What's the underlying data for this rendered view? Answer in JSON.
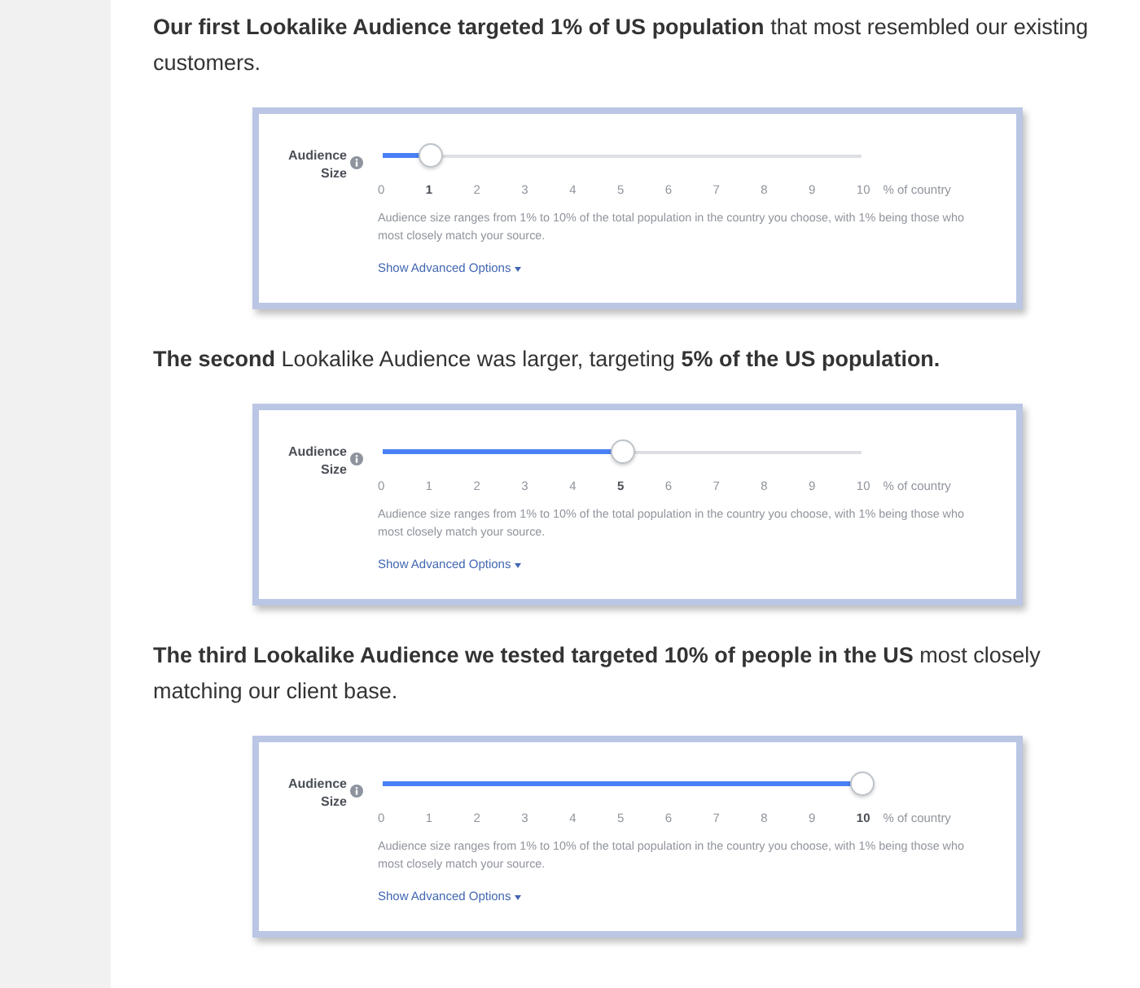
{
  "sections": [
    {
      "text": "**Our first Lookalike Audience targeted 1% of US population** that most resembled our existing customers.",
      "card": {
        "label": "Audience Size",
        "level": 0.1,
        "ticks": [
          {
            "label": "0",
            "selected": false
          },
          {
            "label": "1",
            "selected": true
          },
          {
            "label": "2",
            "selected": false
          },
          {
            "label": "3",
            "selected": false
          },
          {
            "label": "4",
            "selected": false
          },
          {
            "label": "5",
            "selected": false
          },
          {
            "label": "6",
            "selected": false
          },
          {
            "label": "7",
            "selected": false
          },
          {
            "label": "8",
            "selected": false
          },
          {
            "label": "9",
            "selected": false
          },
          {
            "label": "10",
            "selected": false
          }
        ],
        "unit": "% of country",
        "help": "Audience size ranges from 1% to 10% of the total population in the country you choose, with 1% being those who most closely match your source.",
        "link": "Show Advanced Options"
      }
    },
    {
      "text": "**The second** Lookalike Audience was larger, targeting **5% of the US population.**",
      "card": {
        "label": "Audience Size",
        "level": 0.5,
        "ticks": [
          {
            "label": "0",
            "selected": false
          },
          {
            "label": "1",
            "selected": false
          },
          {
            "label": "2",
            "selected": false
          },
          {
            "label": "3",
            "selected": false
          },
          {
            "label": "4",
            "selected": false
          },
          {
            "label": "5",
            "selected": true
          },
          {
            "label": "6",
            "selected": false
          },
          {
            "label": "7",
            "selected": false
          },
          {
            "label": "8",
            "selected": false
          },
          {
            "label": "9",
            "selected": false
          },
          {
            "label": "10",
            "selected": false
          }
        ],
        "unit": "% of country",
        "help": "Audience size ranges from 1% to 10% of the total population in the country you choose, with 1% being those who most closely match your source.",
        "link": "Show Advanced Options"
      }
    },
    {
      "text": "**The third Lookalike Audience we tested targeted 10% of people in the US** most closely matching our client base.",
      "card": {
        "label": "Audience Size",
        "level": 1,
        "ticks": [
          {
            "label": "0",
            "selected": false
          },
          {
            "label": "1",
            "selected": false
          },
          {
            "label": "2",
            "selected": false
          },
          {
            "label": "3",
            "selected": false
          },
          {
            "label": "4",
            "selected": false
          },
          {
            "label": "5",
            "selected": false
          },
          {
            "label": "6",
            "selected": false
          },
          {
            "label": "7",
            "selected": false
          },
          {
            "label": "8",
            "selected": false
          },
          {
            "label": "9",
            "selected": false
          },
          {
            "label": "10",
            "selected": true
          }
        ],
        "unit": "% of country",
        "help": "Audience size ranges from 1% to 10% of the total population in the country you choose, with 1% being those who most closely match your source.",
        "link": "Show Advanced Options"
      }
    }
  ]
}
